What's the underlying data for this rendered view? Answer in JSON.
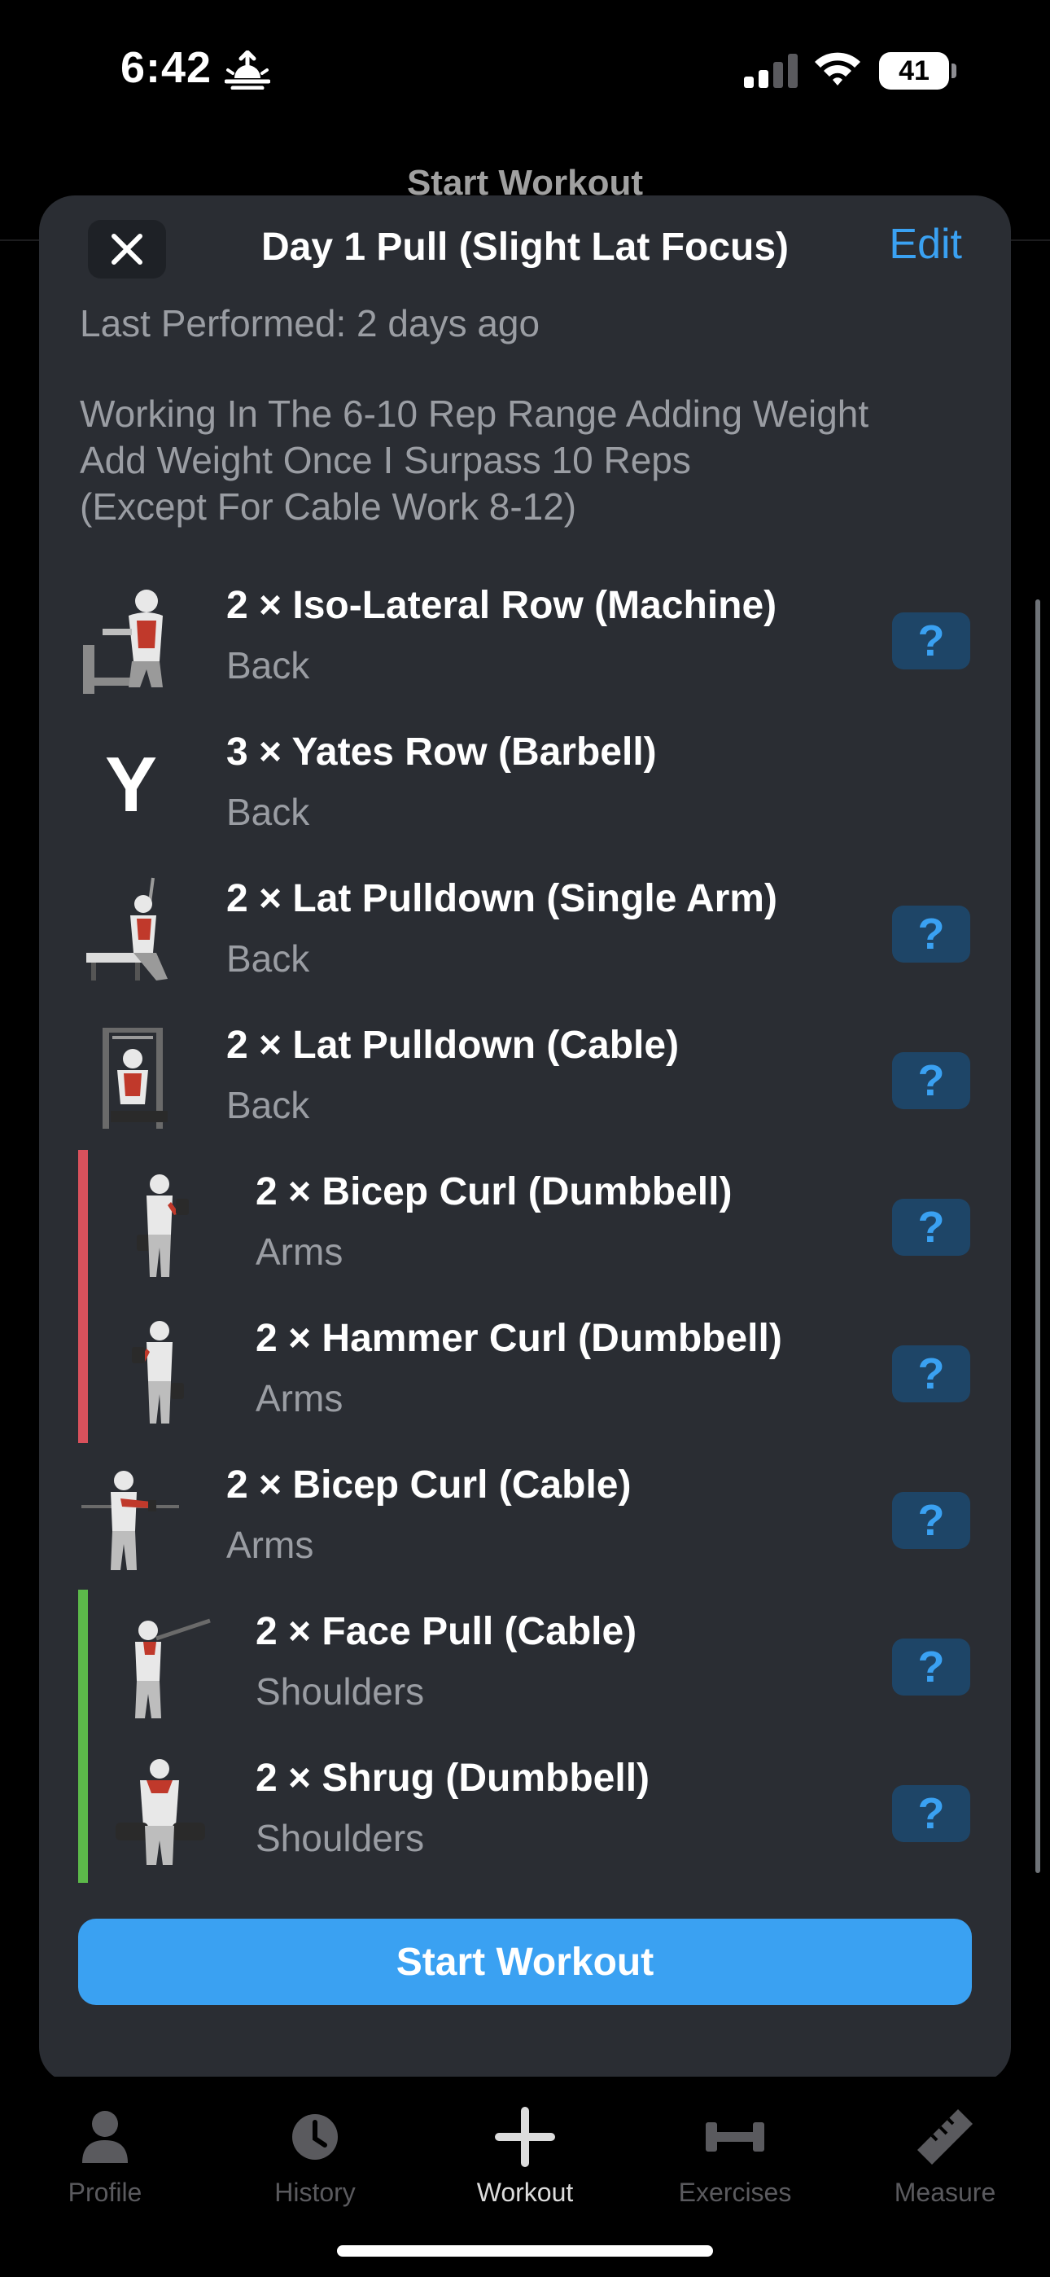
{
  "status_bar": {
    "time": "6:42",
    "battery": "41"
  },
  "background": {
    "title": "Start Workout"
  },
  "modal": {
    "title": "Day 1 Pull (Slight Lat Focus)",
    "edit_label": "Edit",
    "last_performed": "Last Performed: 2 days ago",
    "notes": [
      "Working In The 6-10 Rep Range Adding Weight",
      "Add Weight Once I Surpass 10 Reps",
      "(Except For Cable Work 8-12)"
    ],
    "exercises": [
      {
        "name": "2 × Iso-Lateral Row (Machine)",
        "category": "Back",
        "thumbnail": "iso-lateral-row-illustration",
        "help": "?"
      },
      {
        "name": "3 × Yates Row (Barbell)",
        "category": "Back",
        "thumbnail_letter": "Y"
      },
      {
        "name": "2 × Lat Pulldown (Single Arm)",
        "category": "Back",
        "thumbnail": "single-arm-pulldown-illustration",
        "help": "?"
      },
      {
        "name": "2 × Lat Pulldown (Cable)",
        "category": "Back",
        "thumbnail": "cable-pulldown-illustration",
        "help": "?"
      },
      {
        "name": "2 × Bicep Curl (Dumbbell)",
        "category": "Arms",
        "thumbnail": "dumbbell-curl-illustration",
        "help": "?"
      },
      {
        "name": "2 × Hammer Curl (Dumbbell)",
        "category": "Arms",
        "thumbnail": "hammer-curl-illustration",
        "help": "?"
      },
      {
        "name": "2 × Bicep Curl (Cable)",
        "category": "Arms",
        "thumbnail": "cable-curl-illustration",
        "help": "?"
      },
      {
        "name": "2 × Face Pull (Cable)",
        "category": "Shoulders",
        "thumbnail": "face-pull-illustration",
        "help": "?"
      },
      {
        "name": "2 × Shrug (Dumbbell)",
        "category": "Shoulders",
        "thumbnail": "shrug-illustration",
        "help": "?"
      }
    ],
    "superset_colors": {
      "arms": "#d9515c",
      "shoulders": "#5cb94a"
    },
    "start_button": "Start Workout"
  },
  "tab_bar": {
    "tabs": [
      {
        "label": "Profile",
        "icon": "person-icon"
      },
      {
        "label": "History",
        "icon": "clock-icon"
      },
      {
        "label": "Workout",
        "icon": "plus-icon"
      },
      {
        "label": "Exercises",
        "icon": "dumbbell-icon"
      },
      {
        "label": "Measure",
        "icon": "ruler-icon"
      }
    ]
  },
  "colors": {
    "accent": "#3aa1f2",
    "sheet": "#2a2d33",
    "help_bg": "#1e4567"
  }
}
